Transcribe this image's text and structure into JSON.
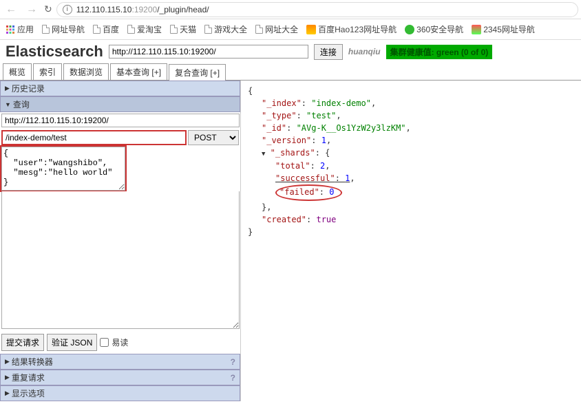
{
  "browser": {
    "url_host": "112.110.115.10",
    "url_port": ":19200",
    "url_path": "/_plugin/head/"
  },
  "bookmarks": {
    "apps": "应用",
    "items": [
      "网址导航",
      "百度",
      "爱淘宝",
      "天猫",
      "游戏大全",
      "网址大全"
    ],
    "hao": "百度Hao123网址导航",
    "safe": "360安全导航",
    "n2345": "2345网址导航"
  },
  "header": {
    "title": "Elasticsearch",
    "conn_url": "http://112.110.115.10:19200/",
    "connect": "连接",
    "user": "huanqiu",
    "health": "集群健康值: green (0 of 0)"
  },
  "tabs": {
    "t0": "概览",
    "t1": "索引",
    "t2": "数据浏览",
    "t3": "基本查询 [+]",
    "t4": "复合查询 [+]"
  },
  "left": {
    "history": "历史记录",
    "query": "查询",
    "server": "http://112.110.115.10:19200/",
    "path": "/index-demo/test",
    "method": "POST",
    "body": "{\n  \"user\":\"wangshibo\",\n  \"mesg\":\"hello world\"\n}",
    "submit": "提交请求",
    "validate": "验证 JSON",
    "pretty": "易读",
    "transformer": "结果转换器",
    "repeat": "重复请求",
    "display": "显示选项"
  },
  "response": {
    "index_k": "\"_index\"",
    "index_v": "\"index-demo\"",
    "type_k": "\"_type\"",
    "type_v": "\"test\"",
    "id_k": "\"_id\"",
    "id_v": "\"AVg-K__Os1YzW2y3lzKM\"",
    "version_k": "\"_version\"",
    "version_v": "1",
    "shards_k": "\"_shards\"",
    "total_k": "\"total\"",
    "total_v": "2",
    "succ_k": "\"successful\"",
    "succ_v": "1",
    "failed_k": "\"failed\"",
    "failed_v": "0",
    "created_k": "\"created\"",
    "created_v": "true"
  }
}
